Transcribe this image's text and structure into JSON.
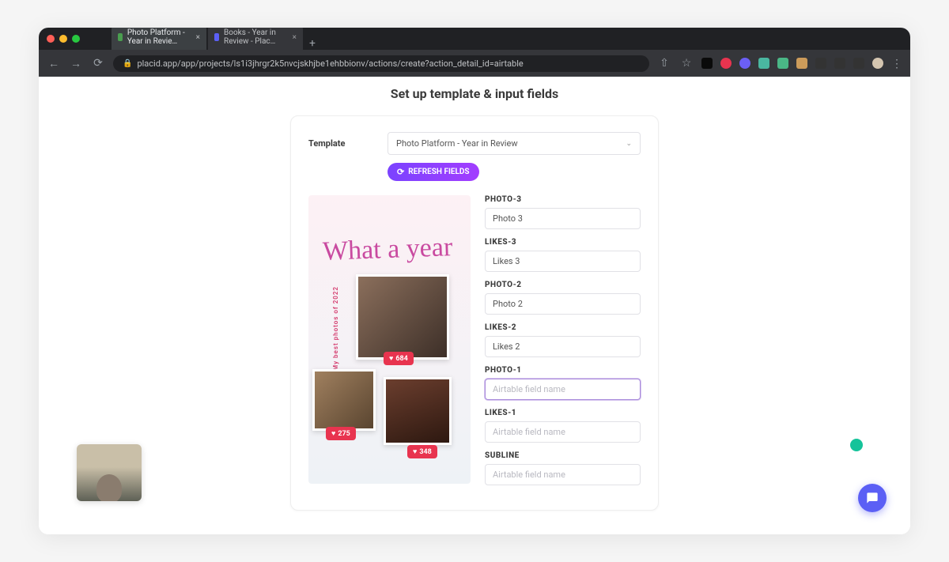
{
  "tabs": [
    {
      "label": "Photo Platform - Year in Revie…",
      "favicon": "#4a9e4f"
    },
    {
      "label": "Books - Year in Review - Plac…",
      "favicon": "#5b5ff5"
    }
  ],
  "url": "placid.app/app/projects/ls1i3jhrgr2k5nvcjskhjbe1ehbbionv/actions/create?action_detail_id=airtable",
  "page": {
    "title": "Set up template & input fields",
    "template_label": "Template",
    "template_value": "Photo Platform - Year in Review",
    "refresh_label": "REFRESH FIELDS"
  },
  "preview": {
    "heading": "What a year",
    "sideline": "My best photos of 2022",
    "likes": [
      "684",
      "275",
      "348"
    ]
  },
  "fields": [
    {
      "label": "PHOTO-3",
      "value": "Photo 3",
      "placeholder": ""
    },
    {
      "label": "LIKES-3",
      "value": "Likes 3",
      "placeholder": ""
    },
    {
      "label": "PHOTO-2",
      "value": "Photo 2",
      "placeholder": ""
    },
    {
      "label": "LIKES-2",
      "value": "Likes 2",
      "placeholder": ""
    },
    {
      "label": "PHOTO-1",
      "value": "",
      "placeholder": "Airtable field name",
      "focused": true
    },
    {
      "label": "LIKES-1",
      "value": "",
      "placeholder": "Airtable field name"
    },
    {
      "label": "SUBLINE",
      "value": "",
      "placeholder": "Airtable field name"
    }
  ]
}
